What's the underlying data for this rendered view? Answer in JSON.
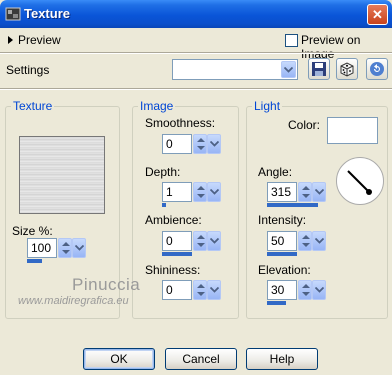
{
  "window": {
    "title": "Texture",
    "close_label": "✕",
    "icon": "texture-app-icon"
  },
  "preview": {
    "label": "Preview",
    "on_image_label": "Preview on Image",
    "on_image_checked": false
  },
  "settings": {
    "label": "Settings",
    "preset_value": "",
    "icons": [
      "save-icon",
      "randomize-dice-icon",
      "reset-icon"
    ]
  },
  "texture_group": {
    "label": "Texture",
    "size_label": "Size %:",
    "size_value": "100",
    "size_level": 0.25
  },
  "image_group": {
    "label": "Image",
    "smoothness": {
      "label": "Smoothness:",
      "value": "0",
      "level": 0.0
    },
    "depth": {
      "label": "Depth:",
      "value": "1",
      "level": 0.06
    },
    "ambience": {
      "label": "Ambience:",
      "value": "0",
      "level": 0.5
    },
    "shininess": {
      "label": "Shininess:",
      "value": "0",
      "level": 0.0
    }
  },
  "light_group": {
    "label": "Light",
    "color_label": "Color:",
    "color_value": "#ffffff",
    "angle": {
      "label": "Angle:",
      "value": "315",
      "level": 0.87
    },
    "intensity": {
      "label": "Intensity:",
      "value": "50",
      "level": 0.5
    },
    "elevation": {
      "label": "Elevation:",
      "value": "30",
      "level": 0.33
    }
  },
  "watermark": {
    "line1": "Pinuccia",
    "line2": "www.maidiregrafica.eu"
  },
  "buttons": {
    "ok": "OK",
    "cancel": "Cancel",
    "help": "Help"
  },
  "colors": {
    "titlebar": "#0a55d8",
    "accent": "#0046d5",
    "slider_fill": "#3169c6"
  }
}
